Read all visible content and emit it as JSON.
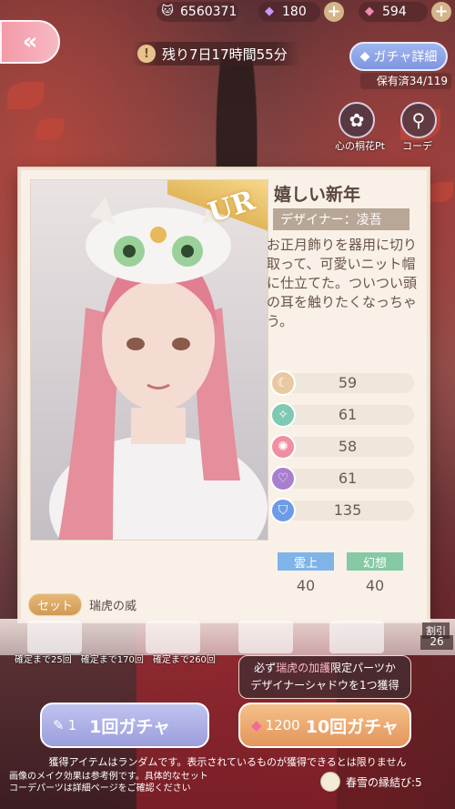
{
  "currency": {
    "coins": "6560371",
    "gems_purple": "180",
    "gems_pink": "594"
  },
  "back_label": "«",
  "timer": "残り7日17時間55分",
  "gacha_detail": "ガチャ詳細",
  "owned": "保有済34/119",
  "side_buttons": {
    "flower_label": "心の桐花Pt",
    "coordinate_label": "コーデ"
  },
  "card": {
    "rarity": "UR",
    "title": "嬉しい新年",
    "designer": "デザイナー：凌吾",
    "description": "お正月飾りを器用に切り取って、可愛いニット帽に仕立てた。ついつい頭の耳を触りたくなっちゃう。",
    "stats": [
      {
        "icon": "elegant-icon",
        "value": "59",
        "color": "#e9c9a2"
      },
      {
        "icon": "fresh-icon",
        "value": "61",
        "color": "#7ec9b2"
      },
      {
        "icon": "sweet-icon",
        "value": "58",
        "color": "#f08fa0"
      },
      {
        "icon": "sexy-icon",
        "value": "61",
        "color": "#a87ecf"
      },
      {
        "icon": "warm-icon",
        "value": "135",
        "color": "#6e9be6"
      }
    ],
    "styles": [
      {
        "label": "雲上",
        "value": "40",
        "color": "#7fb4e8"
      },
      {
        "label": "幻想",
        "value": "40",
        "color": "#86c9a4"
      }
    ],
    "set_badge": "セット",
    "set_name": "瑞虎の威"
  },
  "confirm": [
    "確定まで25回",
    "確定まで170回",
    "確定まで260回"
  ],
  "discount_label": "割引",
  "discount_value": "26",
  "bonus": {
    "line1_pre": "必ず",
    "line1_hl": "瑞虎の加護",
    "line1_post": "限定パーツか",
    "line2": "デザイナーシャドウを1つ獲得"
  },
  "pull_single": {
    "cost": "1",
    "label": "1回ガチャ"
  },
  "pull_ten": {
    "cost": "1200",
    "label": "10回ガチャ"
  },
  "disclaimer": "獲得アイテムはランダムです。表示されているものが獲得できるとは限りません",
  "footnote_1": "画像のメイク効果は参考例です。具体的なセット",
  "footnote_2": "コーデパーツは詳細ページをご確認ください",
  "event_link": "春雪の縁結び:5"
}
